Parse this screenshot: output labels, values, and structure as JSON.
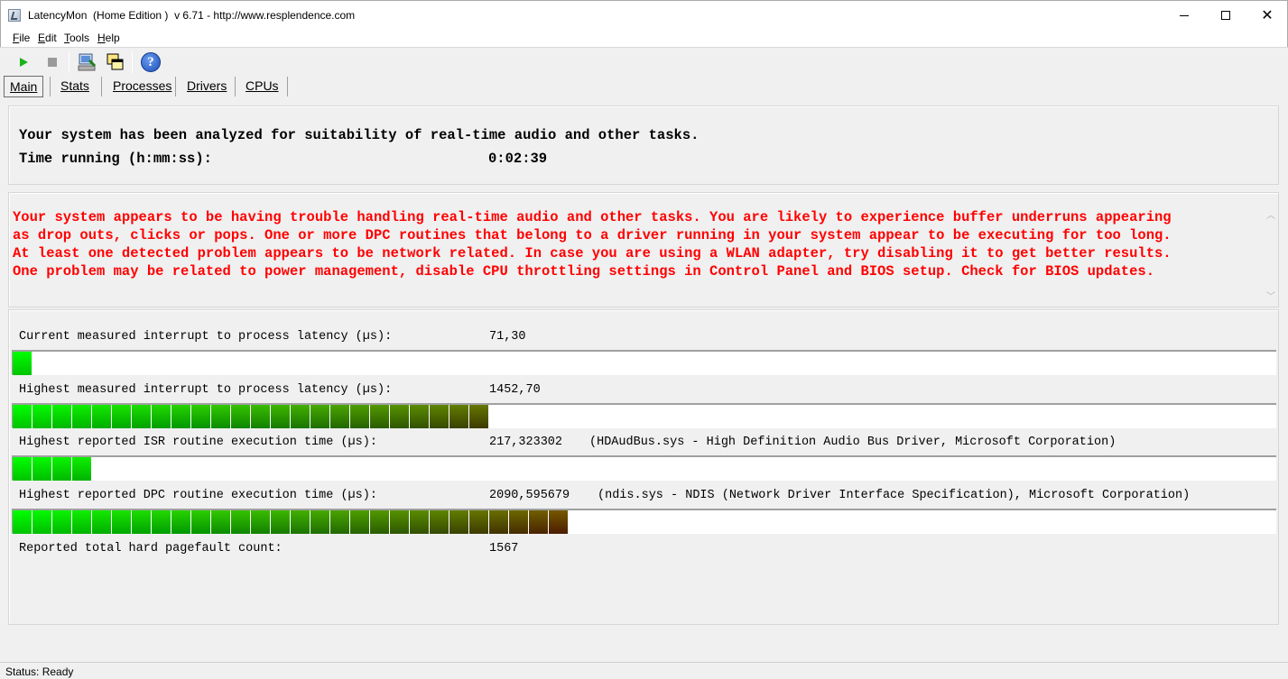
{
  "window": {
    "title": "LatencyMon  (Home Edition )  v 6.71 - http://www.resplendence.com",
    "controls": {
      "close": "✕"
    }
  },
  "menu": [
    {
      "label": "File"
    },
    {
      "label": "Edit"
    },
    {
      "label": "Tools"
    },
    {
      "label": "Help"
    }
  ],
  "toolbar": {
    "buttons": [
      "start-icon",
      "stop-icon",
      "system-info-icon",
      "windows-icon",
      "help-icon"
    ],
    "help_glyph": "?"
  },
  "tabs": [
    {
      "label": "Main",
      "active": true
    },
    {
      "label": "Stats",
      "active": false
    },
    {
      "label": "Processes",
      "active": false
    },
    {
      "label": "Drivers",
      "active": false
    },
    {
      "label": "CPUs",
      "active": false
    }
  ],
  "summary": {
    "line1": "Your system has been analyzed for suitability of real-time audio and other tasks.",
    "time_label": "Time running (h:mm:ss):",
    "time_value": "0:02:39"
  },
  "verdict": {
    "color": "#ff0000",
    "text": "Your system appears to be having trouble handling real-time audio and other tasks. You are likely to experience buffer underruns appearing\nas drop outs, clicks or pops. One or more DPC routines that belong to a driver running in your system appear to be executing for too long.\nAt least one detected problem appears to be network related. In case you are using a WLAN adapter, try disabling it to get better results.\nOne problem may be related to power management, disable CPU throttling settings in Control Panel and BIOS setup. Check for BIOS updates."
  },
  "metrics": {
    "current": {
      "label": "Current measured interrupt to process latency (µs):",
      "value": "71,30",
      "bar_segments": 1
    },
    "highest_latency": {
      "label": "Highest measured interrupt to process latency (µs):",
      "value": "1452,70",
      "bar_segments": 24
    },
    "isr": {
      "label": "Highest reported ISR routine execution time (µs):",
      "value": "217,323302",
      "detail": "(HDAudBus.sys - High Definition Audio Bus Driver, Microsoft Corporation)",
      "bar_segments": 4
    },
    "dpc": {
      "label": "Highest reported DPC routine execution time (µs):",
      "value": "2090,595679",
      "detail": "(ndis.sys - NDIS (Network Driver Interface Specification), Microsoft Corporation)",
      "bar_segments": 28
    },
    "pagefault": {
      "label": "Reported total hard pagefault count:",
      "value": "1567"
    }
  },
  "status": "Status: Ready"
}
